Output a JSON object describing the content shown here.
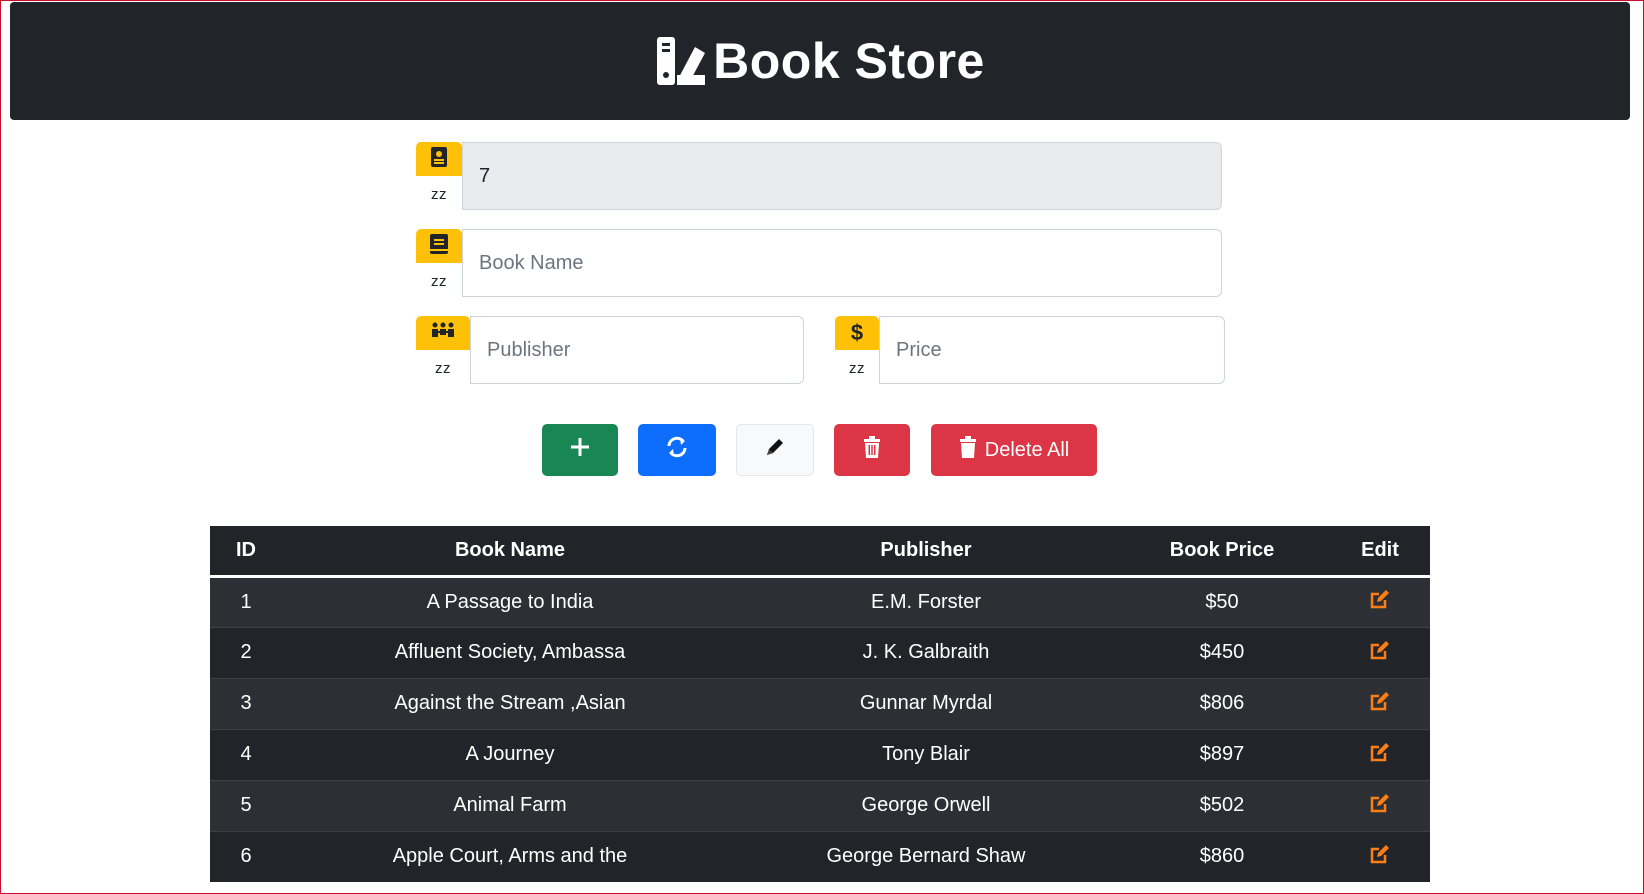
{
  "header": {
    "title": "Book Store",
    "logo_icon": "book-shelf-icon"
  },
  "form": {
    "id_field": {
      "value": "7",
      "addon_icon": "id-card-icon",
      "addon_sub": "zz"
    },
    "name_field": {
      "placeholder": "Book Name",
      "addon_icon": "book-icon",
      "addon_sub": "zz"
    },
    "publisher_field": {
      "placeholder": "Publisher",
      "addon_icon": "people-icon",
      "addon_sub": "zz"
    },
    "price_field": {
      "placeholder": "Price",
      "addon_icon": "dollar-icon",
      "addon_sub": "zz"
    }
  },
  "buttons": {
    "delete_all_label": "Delete All"
  },
  "colors": {
    "accent": "#ffc107",
    "success": "#198754",
    "primary": "#0d6efd",
    "danger": "#dc3545",
    "edit": "#fd7e14",
    "table_dark": "#212529"
  },
  "table": {
    "headers": [
      "ID",
      "Book Name",
      "Publisher",
      "Book Price",
      "Edit"
    ],
    "rows": [
      {
        "id": "1",
        "name": "A Passage to India",
        "publisher": "E.M. Forster",
        "price": "$50"
      },
      {
        "id": "2",
        "name": "Affluent Society, Ambassa",
        "publisher": "J. K. Galbraith",
        "price": "$450"
      },
      {
        "id": "3",
        "name": "Against the Stream ,Asian",
        "publisher": "Gunnar Myrdal",
        "price": "$806"
      },
      {
        "id": "4",
        "name": "A Journey",
        "publisher": "Tony Blair",
        "price": "$897"
      },
      {
        "id": "5",
        "name": "Animal Farm",
        "publisher": "George Orwell",
        "price": "$502"
      },
      {
        "id": "6",
        "name": "Apple Court, Arms and the",
        "publisher": "George Bernard Shaw",
        "price": "$860"
      }
    ]
  }
}
